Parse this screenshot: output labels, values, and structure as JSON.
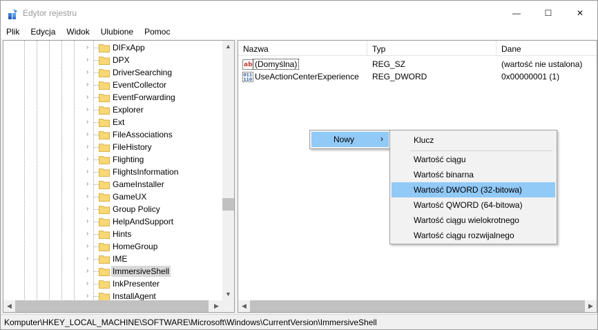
{
  "window": {
    "title": "Edytor rejestru",
    "minimize_glyph": "—",
    "maximize_glyph": "☐",
    "close_glyph": "✕"
  },
  "menu": [
    "Plik",
    "Edycja",
    "Widok",
    "Ulubione",
    "Pomoc"
  ],
  "tree": {
    "items": [
      "DIFxApp",
      "DPX",
      "DriverSearching",
      "EventCollector",
      "EventForwarding",
      "Explorer",
      "Ext",
      "FileAssociations",
      "FileHistory",
      "Flighting",
      "FlightsInformation",
      "GameInstaller",
      "GameUX",
      "Group Policy",
      "HelpAndSupport",
      "Hints",
      "HomeGroup",
      "IME",
      "ImmersiveShell",
      "InkPresenter",
      "InstallAgent"
    ],
    "selected": "ImmersiveShell"
  },
  "list": {
    "columns": [
      "Nazwa",
      "Typ",
      "Dane"
    ],
    "rows": [
      {
        "icon": "string-value-icon",
        "name": "(Domyślna)",
        "type": "REG_SZ",
        "data": "(wartość nie ustalona)"
      },
      {
        "icon": "binary-value-icon",
        "name": "UseActionCenterExperience",
        "type": "REG_DWORD",
        "data": "0x00000001 (1)"
      }
    ]
  },
  "context_menu": {
    "label": "Nowy",
    "arrow": "›"
  },
  "submenu": {
    "items": [
      "Klucz",
      "Wartość ciągu",
      "Wartość binarna",
      "Wartość DWORD (32-bitowa)",
      "Wartość QWORD (64-bitowa)",
      "Wartość ciągu wielokrotnego",
      "Wartość ciągu rozwijalnego"
    ],
    "highlighted": "Wartość DWORD (32-bitowa)"
  },
  "status": {
    "path": "Komputer\\HKEY_LOCAL_MACHINE\\SOFTWARE\\Microsoft\\Windows\\CurrentVersion\\ImmersiveShell"
  },
  "colors": {
    "highlight": "#91c9f7",
    "folder": "#f8d775",
    "selected_tree": "#d9d9d9"
  }
}
